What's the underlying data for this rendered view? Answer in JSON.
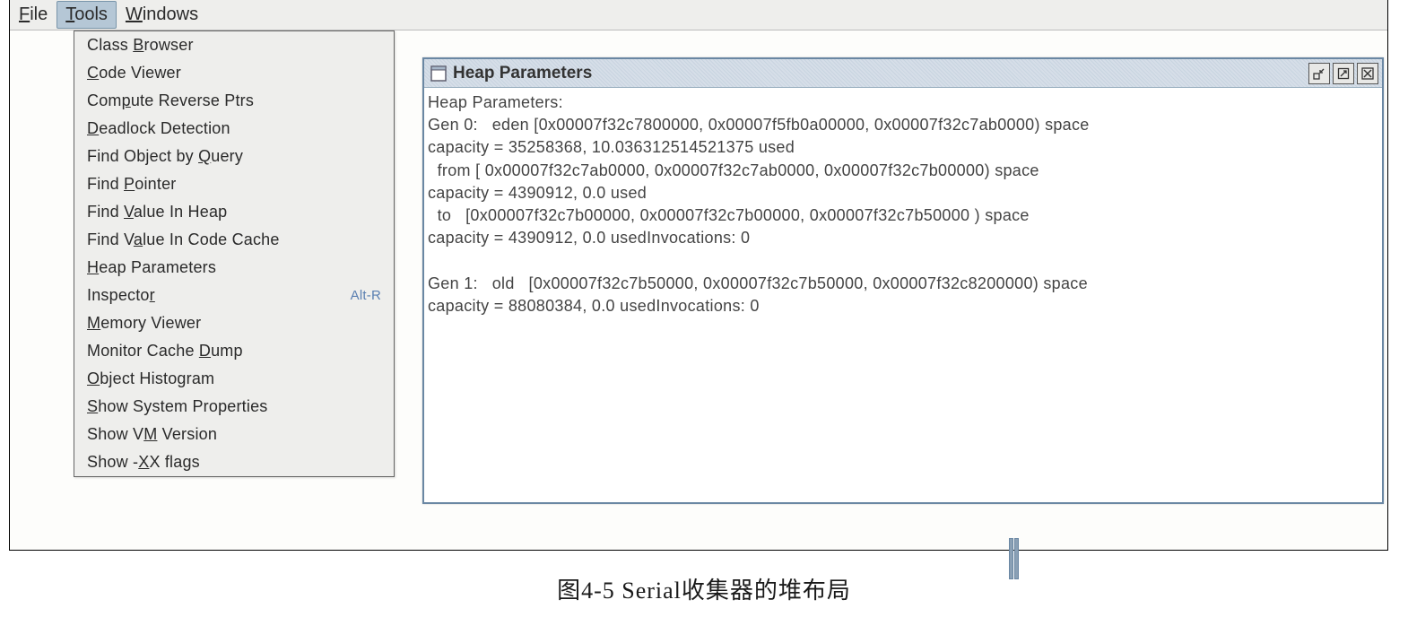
{
  "menubar": {
    "items": [
      {
        "label_pre": "",
        "mn": "F",
        "label_post": "ile",
        "selected": false
      },
      {
        "label_pre": "",
        "mn": "T",
        "label_post": "ools",
        "selected": true
      },
      {
        "label_pre": "",
        "mn": "W",
        "label_post": "indows",
        "selected": false
      }
    ]
  },
  "dropdown": {
    "items": [
      {
        "pre": "Class ",
        "mn": "B",
        "post": "rowser",
        "shortcut": ""
      },
      {
        "pre": "",
        "mn": "C",
        "post": "ode Viewer",
        "shortcut": ""
      },
      {
        "pre": "Com",
        "mn": "p",
        "post": "ute Reverse Ptrs",
        "shortcut": ""
      },
      {
        "pre": "",
        "mn": "D",
        "post": "eadlock Detection",
        "shortcut": ""
      },
      {
        "pre": "Find Object by ",
        "mn": "Q",
        "post": "uery",
        "shortcut": ""
      },
      {
        "pre": "Find ",
        "mn": "P",
        "post": "ointer",
        "shortcut": ""
      },
      {
        "pre": "Find ",
        "mn": "V",
        "post": "alue In Heap",
        "shortcut": ""
      },
      {
        "pre": "Find V",
        "mn": "a",
        "post": "lue In Code Cache",
        "shortcut": ""
      },
      {
        "pre": "",
        "mn": "H",
        "post": "eap Parameters",
        "shortcut": ""
      },
      {
        "pre": "Inspecto",
        "mn": "r",
        "post": "",
        "shortcut": "Alt-R"
      },
      {
        "pre": "",
        "mn": "M",
        "post": "emory Viewer",
        "shortcut": ""
      },
      {
        "pre": "Monitor Cache ",
        "mn": "D",
        "post": "ump",
        "shortcut": ""
      },
      {
        "pre": "",
        "mn": "O",
        "post": "bject Histogram",
        "shortcut": ""
      },
      {
        "pre": "",
        "mn": "S",
        "post": "how System Properties",
        "shortcut": ""
      },
      {
        "pre": "Show V",
        "mn": "M",
        "post": " Version",
        "shortcut": ""
      },
      {
        "pre": "Show -",
        "mn": "X",
        "post": "X flags",
        "shortcut": ""
      }
    ]
  },
  "window": {
    "title": "Heap Parameters",
    "body": "Heap Parameters:\nGen 0:   eden [0x00007f32c7800000, 0x00007f5fb0a00000, 0x00007f32c7ab0000) space\ncapacity = 35258368, 10.036312514521375 used\n  from [ 0x00007f32c7ab0000, 0x00007f32c7ab0000, 0x00007f32c7b00000) space\ncapacity = 4390912, 0.0 used\n  to   [0x00007f32c7b00000, 0x00007f32c7b00000, 0x00007f32c7b50000 ) space\ncapacity = 4390912, 0.0 usedInvocations: 0\n\nGen 1:   old   [0x00007f32c7b50000, 0x00007f32c7b50000, 0x00007f32c8200000) space\ncapacity = 88080384, 0.0 usedInvocations: 0"
  },
  "caption": "图4-5   Serial收集器的堆布局"
}
